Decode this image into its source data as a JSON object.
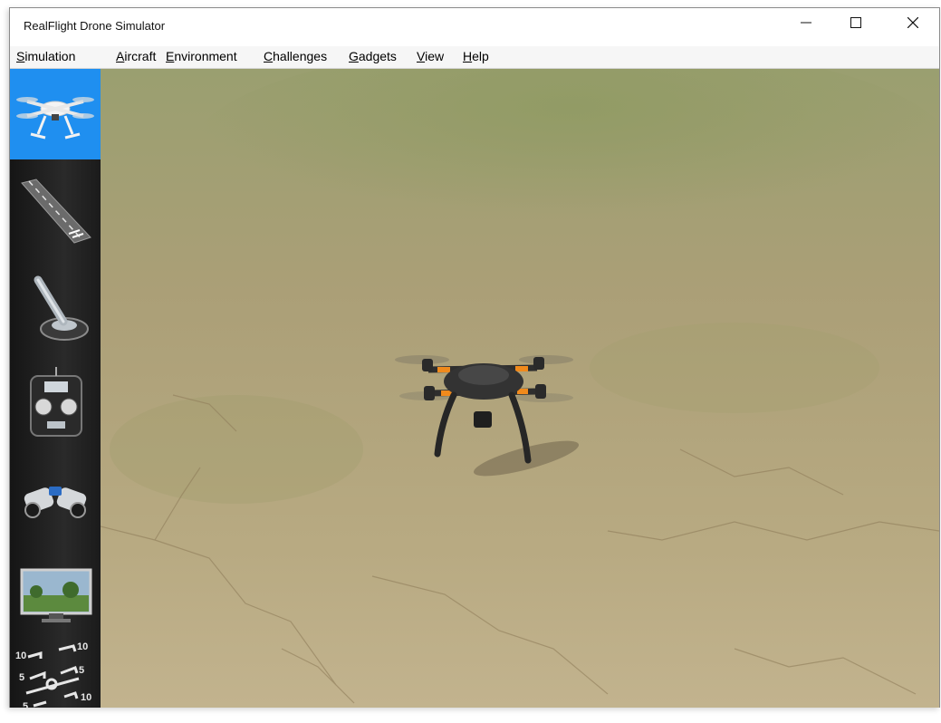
{
  "window": {
    "title": "RealFlight Drone Simulator",
    "controls": [
      "minimize-icon",
      "maximize-icon",
      "close-icon"
    ]
  },
  "menu": {
    "items": [
      {
        "label": "Simulation",
        "mnemonic": "S"
      },
      {
        "label": "Aircraft",
        "mnemonic": "A"
      },
      {
        "label": "Environment",
        "mnemonic": "E"
      },
      {
        "label": "Challenges",
        "mnemonic": "C"
      },
      {
        "label": "Gadgets",
        "mnemonic": "G"
      },
      {
        "label": "View",
        "mnemonic": "V"
      },
      {
        "label": "Help",
        "mnemonic": "H"
      }
    ]
  },
  "toolbar": {
    "tools": [
      {
        "icon": "drone-icon",
        "active": true
      },
      {
        "icon": "runway-icon",
        "active": false
      },
      {
        "icon": "joystick-icon",
        "active": false
      },
      {
        "icon": "transmitter-icon",
        "active": false
      },
      {
        "icon": "binoculars-icon",
        "active": false
      },
      {
        "icon": "monitor-scenery-icon",
        "active": false
      },
      {
        "icon": "pitch-ladder-icon",
        "active": false
      }
    ]
  },
  "colors": {
    "active_tool": "#1f8ff0",
    "ground": "#b4a77c",
    "drone_body": "#2e2e2e",
    "drone_accent": "#f08a1c"
  }
}
